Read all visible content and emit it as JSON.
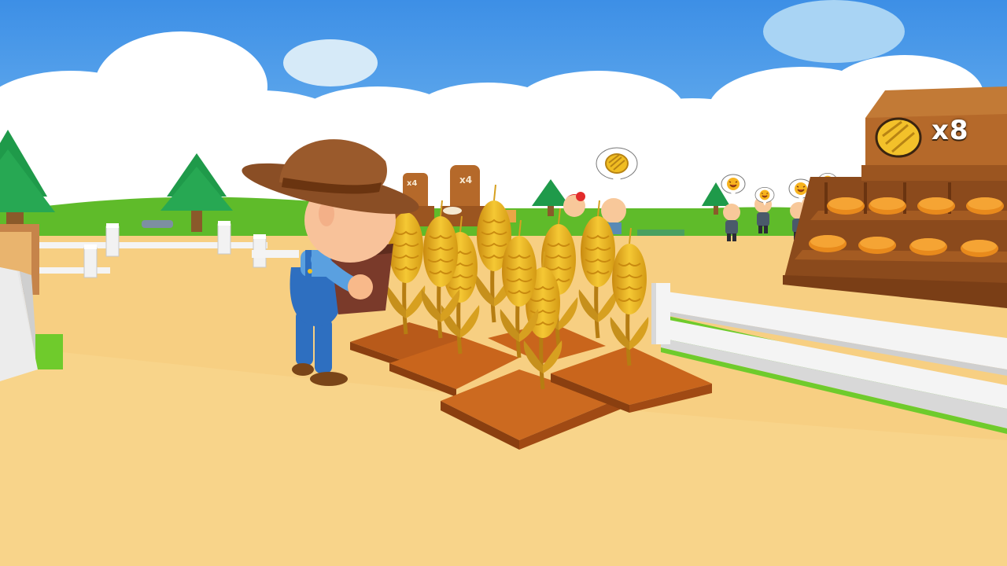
{
  "bread_stand": {
    "count_label": "x8",
    "icon": "bread-icon"
  },
  "background_signs": [
    {
      "label": "x4"
    },
    {
      "label": "x4"
    }
  ],
  "customer_bubbles": [
    {
      "icon": "bread-icon"
    },
    {
      "icon": "happy-face-icon"
    },
    {
      "icon": "happy-face-icon"
    },
    {
      "icon": "happy-face-icon"
    },
    {
      "icon": "happy-face-icon"
    }
  ],
  "colors": {
    "sky": "#4a9be8",
    "ground": "#f7cf82",
    "grass": "#6fcb2c",
    "wheat": "#e8b420",
    "soil": "#c9651c",
    "stand_wood": "#b5692a",
    "hat": "#8a4e25",
    "overalls": "#2e6fc0"
  }
}
